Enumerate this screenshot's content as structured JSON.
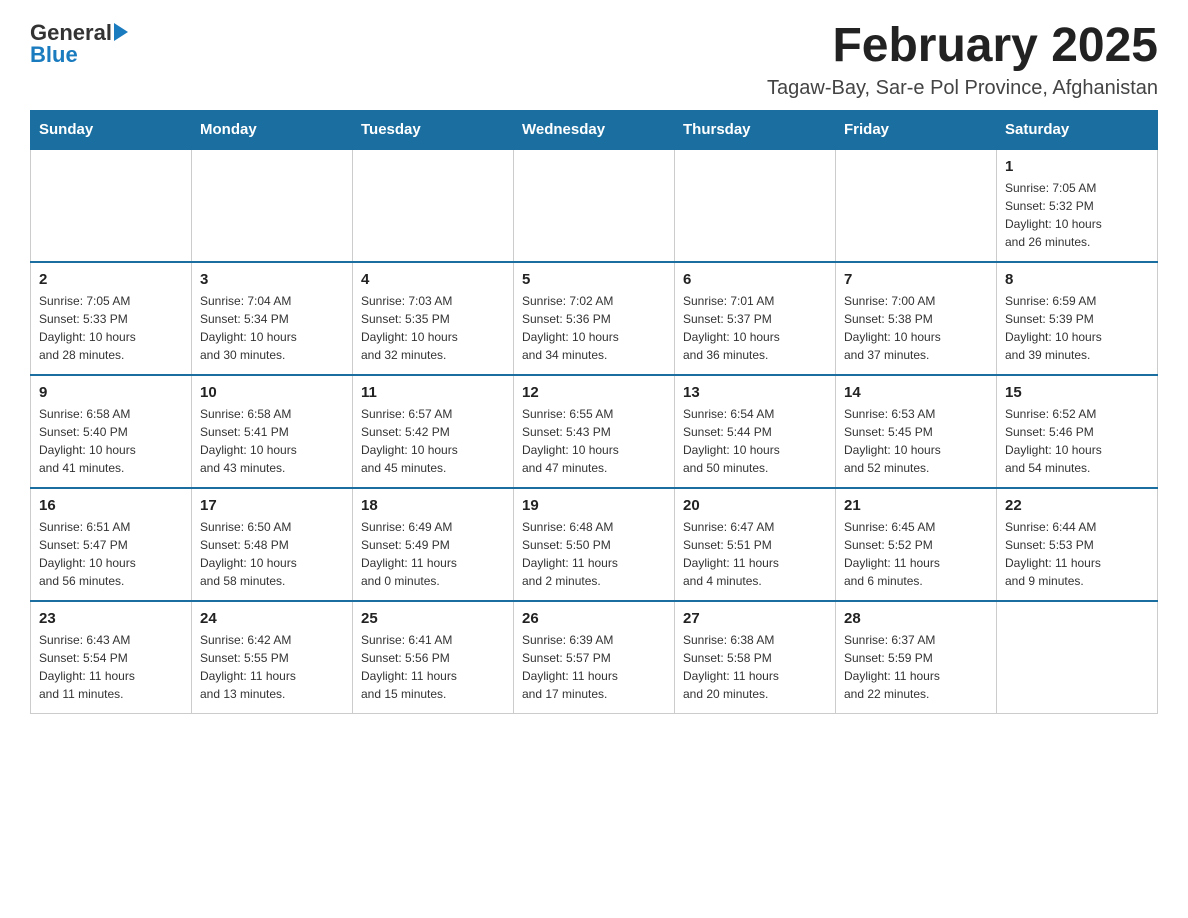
{
  "header": {
    "logo_general": "General",
    "logo_blue": "Blue",
    "month_title": "February 2025",
    "location": "Tagaw-Bay, Sar-e Pol Province, Afghanistan"
  },
  "days_of_week": [
    "Sunday",
    "Monday",
    "Tuesday",
    "Wednesday",
    "Thursday",
    "Friday",
    "Saturday"
  ],
  "weeks": [
    [
      {
        "day": "",
        "info": ""
      },
      {
        "day": "",
        "info": ""
      },
      {
        "day": "",
        "info": ""
      },
      {
        "day": "",
        "info": ""
      },
      {
        "day": "",
        "info": ""
      },
      {
        "day": "",
        "info": ""
      },
      {
        "day": "1",
        "info": "Sunrise: 7:05 AM\nSunset: 5:32 PM\nDaylight: 10 hours\nand 26 minutes."
      }
    ],
    [
      {
        "day": "2",
        "info": "Sunrise: 7:05 AM\nSunset: 5:33 PM\nDaylight: 10 hours\nand 28 minutes."
      },
      {
        "day": "3",
        "info": "Sunrise: 7:04 AM\nSunset: 5:34 PM\nDaylight: 10 hours\nand 30 minutes."
      },
      {
        "day": "4",
        "info": "Sunrise: 7:03 AM\nSunset: 5:35 PM\nDaylight: 10 hours\nand 32 minutes."
      },
      {
        "day": "5",
        "info": "Sunrise: 7:02 AM\nSunset: 5:36 PM\nDaylight: 10 hours\nand 34 minutes."
      },
      {
        "day": "6",
        "info": "Sunrise: 7:01 AM\nSunset: 5:37 PM\nDaylight: 10 hours\nand 36 minutes."
      },
      {
        "day": "7",
        "info": "Sunrise: 7:00 AM\nSunset: 5:38 PM\nDaylight: 10 hours\nand 37 minutes."
      },
      {
        "day": "8",
        "info": "Sunrise: 6:59 AM\nSunset: 5:39 PM\nDaylight: 10 hours\nand 39 minutes."
      }
    ],
    [
      {
        "day": "9",
        "info": "Sunrise: 6:58 AM\nSunset: 5:40 PM\nDaylight: 10 hours\nand 41 minutes."
      },
      {
        "day": "10",
        "info": "Sunrise: 6:58 AM\nSunset: 5:41 PM\nDaylight: 10 hours\nand 43 minutes."
      },
      {
        "day": "11",
        "info": "Sunrise: 6:57 AM\nSunset: 5:42 PM\nDaylight: 10 hours\nand 45 minutes."
      },
      {
        "day": "12",
        "info": "Sunrise: 6:55 AM\nSunset: 5:43 PM\nDaylight: 10 hours\nand 47 minutes."
      },
      {
        "day": "13",
        "info": "Sunrise: 6:54 AM\nSunset: 5:44 PM\nDaylight: 10 hours\nand 50 minutes."
      },
      {
        "day": "14",
        "info": "Sunrise: 6:53 AM\nSunset: 5:45 PM\nDaylight: 10 hours\nand 52 minutes."
      },
      {
        "day": "15",
        "info": "Sunrise: 6:52 AM\nSunset: 5:46 PM\nDaylight: 10 hours\nand 54 minutes."
      }
    ],
    [
      {
        "day": "16",
        "info": "Sunrise: 6:51 AM\nSunset: 5:47 PM\nDaylight: 10 hours\nand 56 minutes."
      },
      {
        "day": "17",
        "info": "Sunrise: 6:50 AM\nSunset: 5:48 PM\nDaylight: 10 hours\nand 58 minutes."
      },
      {
        "day": "18",
        "info": "Sunrise: 6:49 AM\nSunset: 5:49 PM\nDaylight: 11 hours\nand 0 minutes."
      },
      {
        "day": "19",
        "info": "Sunrise: 6:48 AM\nSunset: 5:50 PM\nDaylight: 11 hours\nand 2 minutes."
      },
      {
        "day": "20",
        "info": "Sunrise: 6:47 AM\nSunset: 5:51 PM\nDaylight: 11 hours\nand 4 minutes."
      },
      {
        "day": "21",
        "info": "Sunrise: 6:45 AM\nSunset: 5:52 PM\nDaylight: 11 hours\nand 6 minutes."
      },
      {
        "day": "22",
        "info": "Sunrise: 6:44 AM\nSunset: 5:53 PM\nDaylight: 11 hours\nand 9 minutes."
      }
    ],
    [
      {
        "day": "23",
        "info": "Sunrise: 6:43 AM\nSunset: 5:54 PM\nDaylight: 11 hours\nand 11 minutes."
      },
      {
        "day": "24",
        "info": "Sunrise: 6:42 AM\nSunset: 5:55 PM\nDaylight: 11 hours\nand 13 minutes."
      },
      {
        "day": "25",
        "info": "Sunrise: 6:41 AM\nSunset: 5:56 PM\nDaylight: 11 hours\nand 15 minutes."
      },
      {
        "day": "26",
        "info": "Sunrise: 6:39 AM\nSunset: 5:57 PM\nDaylight: 11 hours\nand 17 minutes."
      },
      {
        "day": "27",
        "info": "Sunrise: 6:38 AM\nSunset: 5:58 PM\nDaylight: 11 hours\nand 20 minutes."
      },
      {
        "day": "28",
        "info": "Sunrise: 6:37 AM\nSunset: 5:59 PM\nDaylight: 11 hours\nand 22 minutes."
      },
      {
        "day": "",
        "info": ""
      }
    ]
  ]
}
